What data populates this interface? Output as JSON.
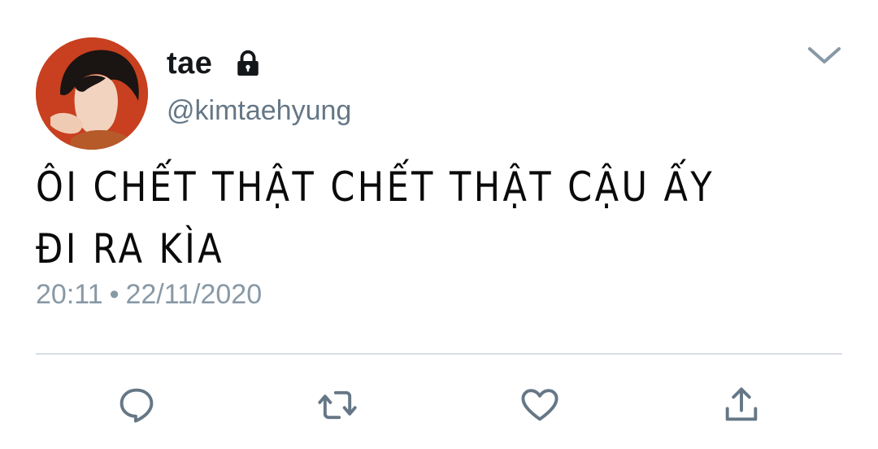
{
  "user": {
    "display_name": "tae",
    "handle": "@kimtaehyung",
    "protected_icon": "lock-icon",
    "avatar": "profile-photo"
  },
  "tweet": {
    "text": "ÔI CHẾT THẬT CHẾT THẬT CẬU ẤY\nĐI RA KÌA",
    "time": "20:11",
    "separator": "•",
    "date": "22/11/2020"
  },
  "actions": {
    "more": "chevron-down-icon",
    "reply": "reply-icon",
    "retweet": "retweet-icon",
    "like": "heart-icon",
    "share": "share-icon"
  },
  "colors": {
    "text": "#14171a",
    "secondary": "#657786",
    "meta": "#8899a6",
    "icons": "#657786",
    "divider": "#d7dde2",
    "avatar_bg": "#c23a1f"
  }
}
